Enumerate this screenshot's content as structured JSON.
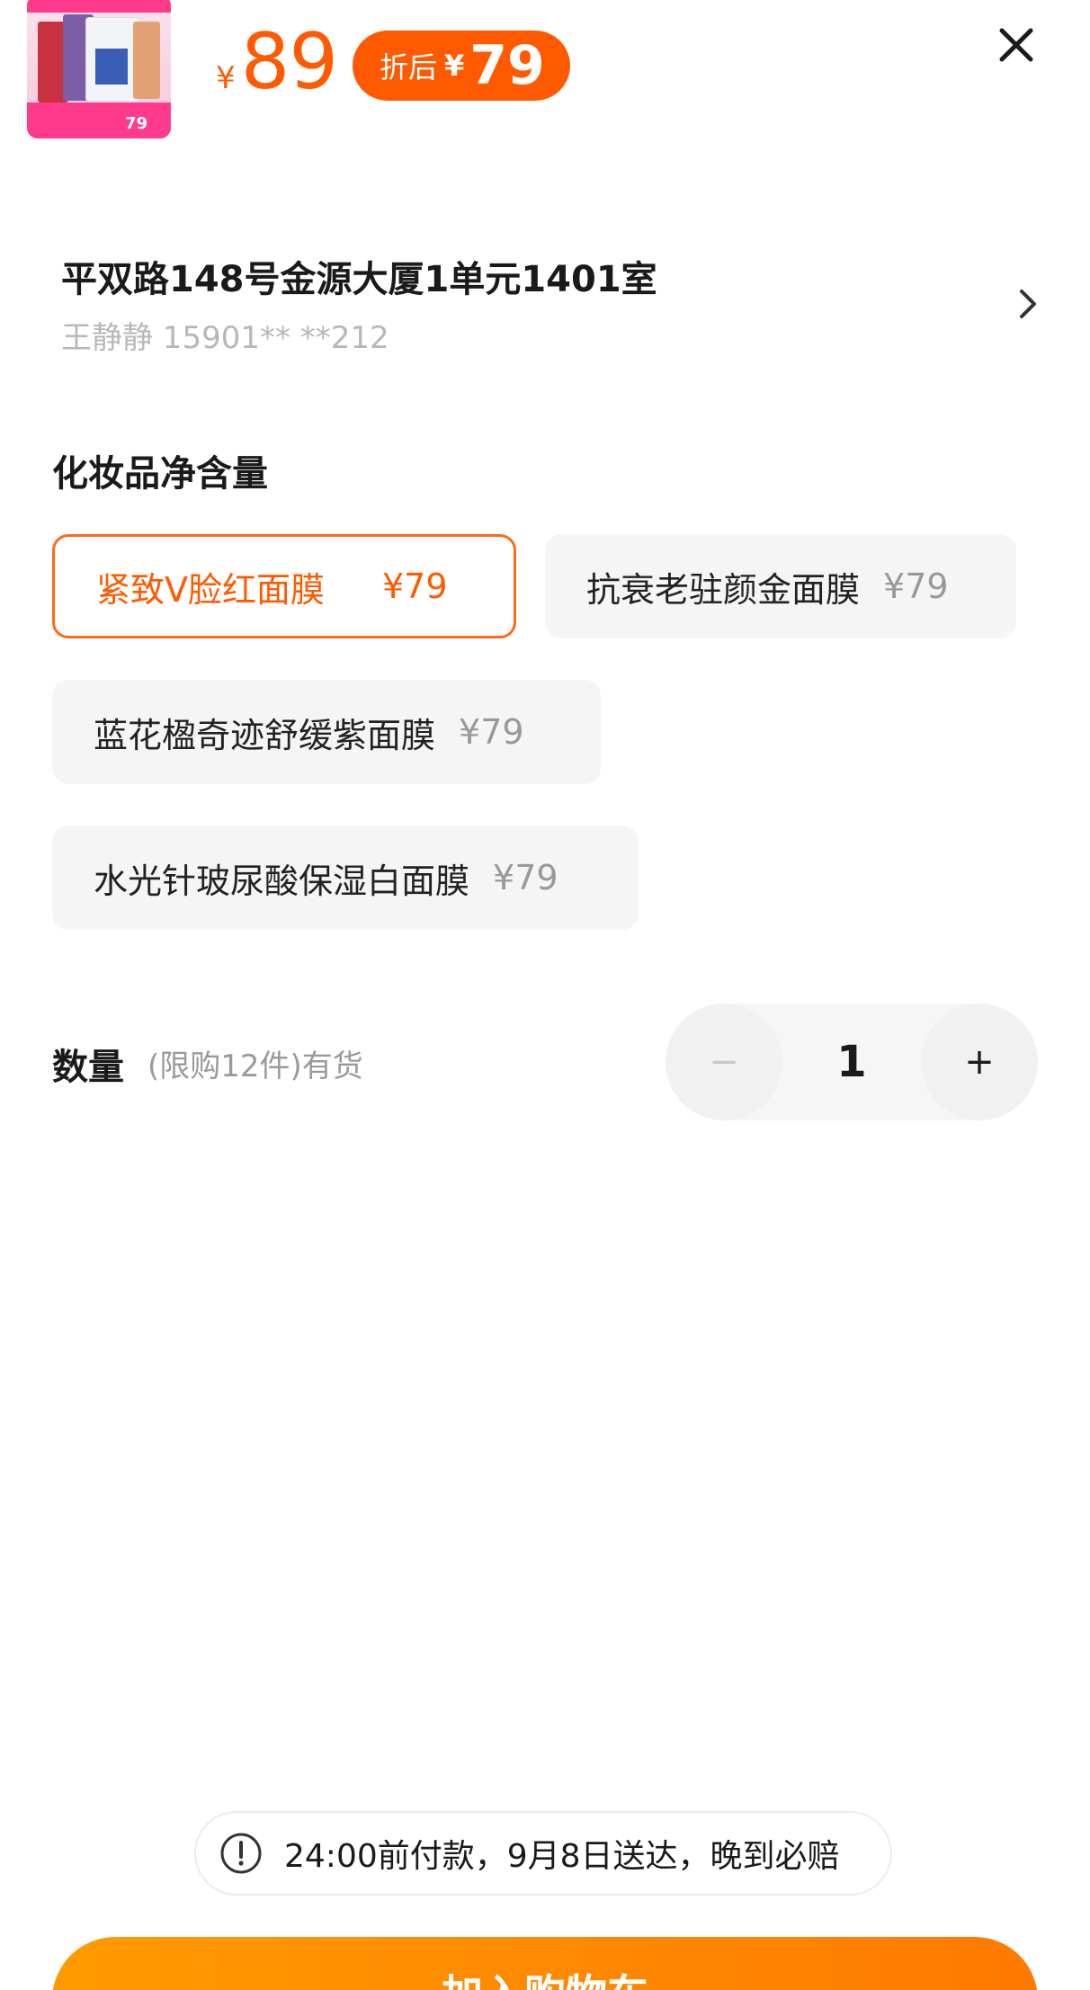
{
  "product": {
    "thumbnail_price": "79",
    "price_symbol": "¥",
    "price": "89",
    "discount_label": "折后",
    "discount_symbol": "¥",
    "discount_price": "79"
  },
  "address": {
    "line": "平双路148号金源大厦1单元1401室",
    "contact": "王静静 15901** **212"
  },
  "spec": {
    "title": "化妆品净含量",
    "options": [
      {
        "name": "紧致V脸红面膜",
        "price": "¥79",
        "selected": true
      },
      {
        "name": "抗衰老驻颜金面膜",
        "price": "¥79",
        "selected": false
      },
      {
        "name": "蓝花楹奇迹舒缓紫面膜",
        "price": "¥79",
        "selected": false
      },
      {
        "name": "水光针玻尿酸保湿白面膜",
        "price": "¥79",
        "selected": false
      }
    ]
  },
  "quantity": {
    "label": "数量",
    "note": "(限购12件)有货",
    "minus": "−",
    "value": "1",
    "plus": "+"
  },
  "notice": {
    "text": "24:00前付款，9月8日送达，晚到必赔"
  },
  "cart_button": {
    "label": "加入购物车"
  },
  "colors": {
    "accent": "#ff5a00",
    "button": "#ff8a00",
    "muted": "#9a9a9a"
  },
  "icons": [
    "close-icon",
    "chevron-right-icon",
    "info-icon"
  ]
}
